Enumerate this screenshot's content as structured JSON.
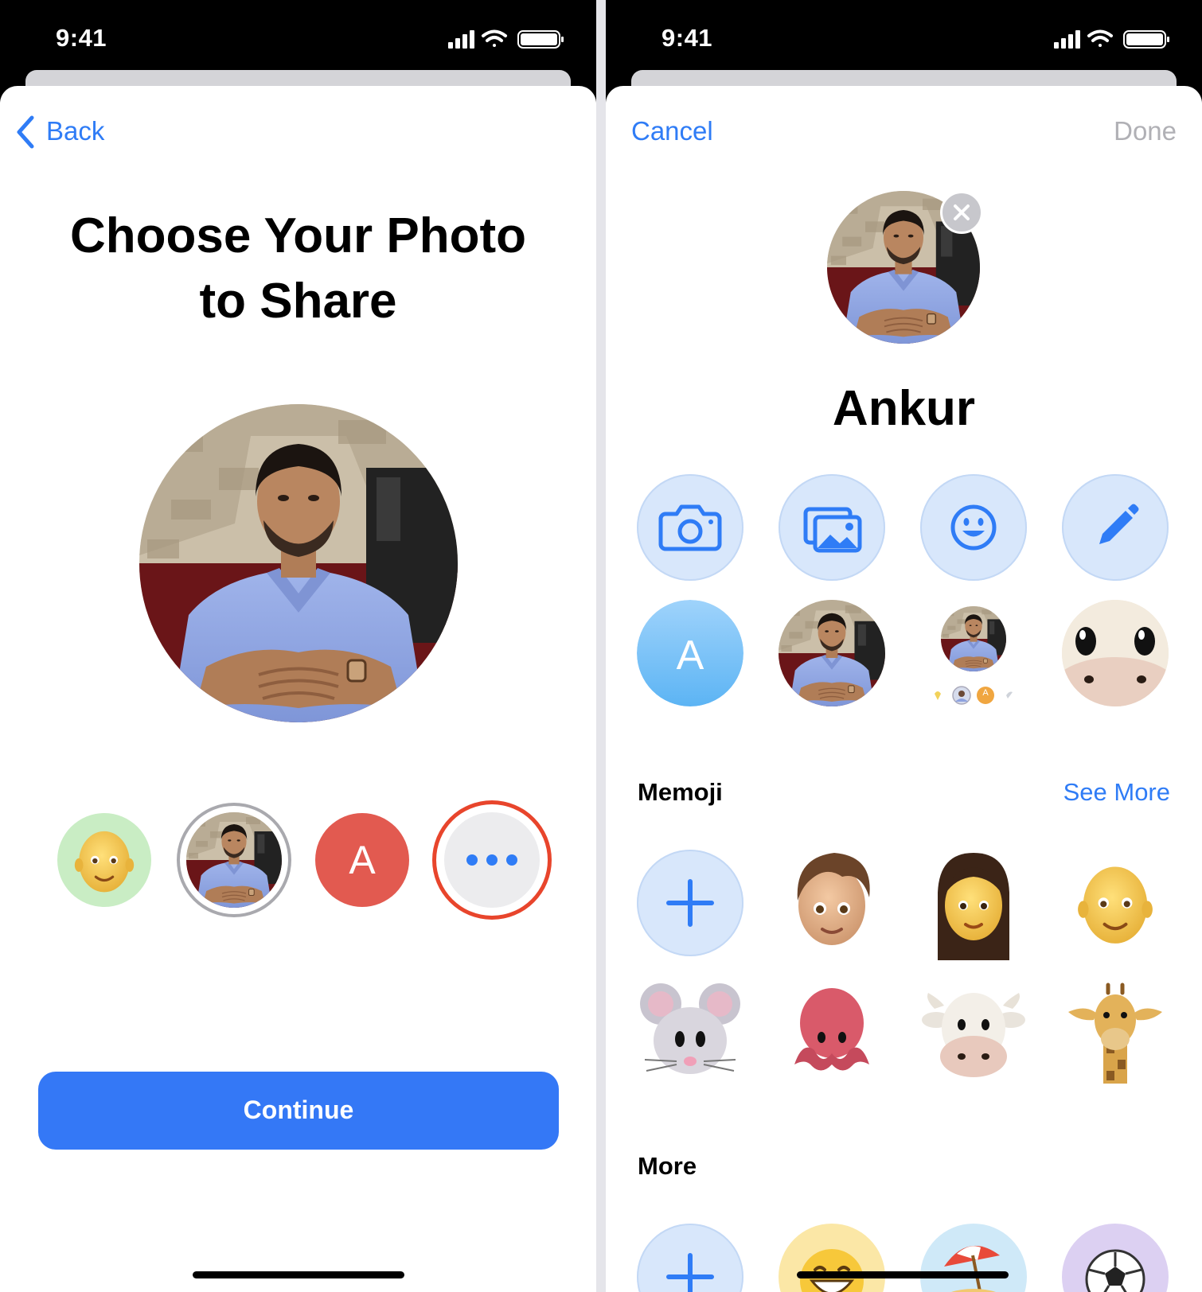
{
  "left": {
    "status": {
      "time": "9:41"
    },
    "nav": {
      "back_label": "Back"
    },
    "title_line1": "Choose Your Photo",
    "title_line2": "to Share",
    "options": [
      {
        "name": "memoji-option"
      },
      {
        "name": "photo-option",
        "selected": true
      },
      {
        "name": "monogram-option",
        "initial": "A"
      },
      {
        "name": "more-options",
        "highlighted": true
      }
    ],
    "continue_label": "Continue"
  },
  "right": {
    "status": {
      "time": "9:41"
    },
    "nav": {
      "cancel_label": "Cancel",
      "done_label": "Done"
    },
    "name": "Ankur",
    "actions": [
      "camera-icon",
      "photos-icon",
      "emoji-icon",
      "pencil-icon"
    ],
    "suggestions": [
      {
        "kind": "monogram",
        "initial": "A"
      },
      {
        "kind": "photo"
      },
      {
        "kind": "photo-small",
        "badge_initial": "A"
      },
      {
        "kind": "animoji-cow"
      }
    ],
    "memoji": {
      "header": "Memoji",
      "see_more": "See More",
      "items": [
        "add-memoji",
        "memoji-boy",
        "memoji-woman",
        "memoji-bald",
        "memoji-mouse",
        "memoji-octopus",
        "memoji-cow",
        "memoji-giraffe"
      ]
    },
    "more": {
      "header": "More",
      "items": [
        "add-more",
        "emoji-grin",
        "emoji-beach",
        "emoji-soccer"
      ]
    }
  },
  "colors": {
    "accent": "#2f7cf6",
    "continue_bg": "#3478f6",
    "highlight_ring": "#e8452c",
    "monogram_red": "#e25a50",
    "done_disabled": "#b0b0b5"
  }
}
